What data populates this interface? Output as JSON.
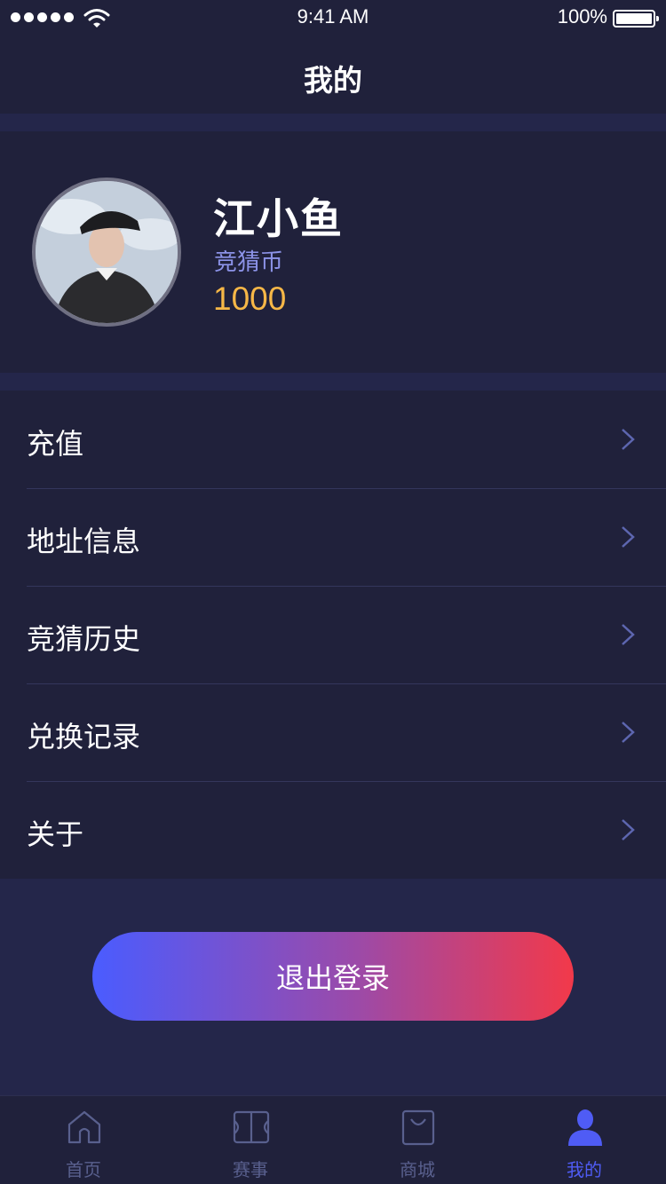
{
  "status_bar": {
    "time": "9:41 AM",
    "battery": "100%"
  },
  "header": {
    "title": "我的"
  },
  "profile": {
    "name": "江小鱼",
    "coin_label": "竞猜币",
    "coin_value": "1000"
  },
  "menu": [
    {
      "label": "充值"
    },
    {
      "label": "地址信息"
    },
    {
      "label": "竞猜历史"
    },
    {
      "label": "兑换记录"
    },
    {
      "label": "关于"
    }
  ],
  "logout_label": "退出登录",
  "tabbar": [
    {
      "label": "首页",
      "icon": "home-icon"
    },
    {
      "label": "赛事",
      "icon": "court-icon"
    },
    {
      "label": "商城",
      "icon": "shopping-bag-icon"
    },
    {
      "label": "我的",
      "icon": "user-icon",
      "active": true
    }
  ],
  "colors": {
    "background": "#20213b",
    "accent": "#4f5cf5",
    "coin": "#f6b747",
    "gradient_start": "#4a5cff",
    "gradient_end": "#f2394a"
  }
}
